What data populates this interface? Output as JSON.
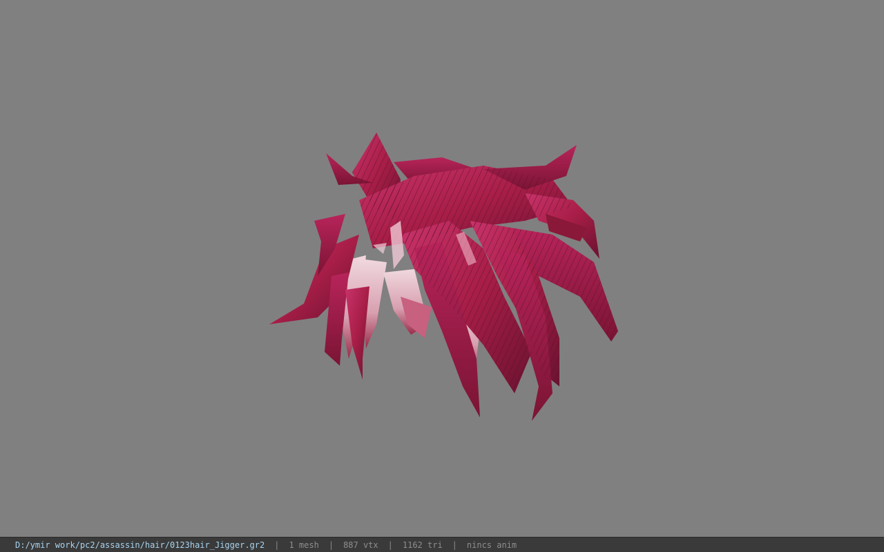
{
  "status_bar": {
    "file_path": "D:/ymir work/pc2/assassin/hair/0123hair_Jigger.gr2",
    "separator": "|",
    "mesh_count": "1 mesh",
    "vertex_count": "887 vtx",
    "triangle_count": "1162 tri",
    "animation": "nincs anim"
  },
  "colors": {
    "background": "#808080",
    "hair_primary": "#b0204e",
    "hair_dark": "#5a0f2a",
    "hair_light": "#e8c8d0",
    "path_text": "#a8d4f0"
  }
}
